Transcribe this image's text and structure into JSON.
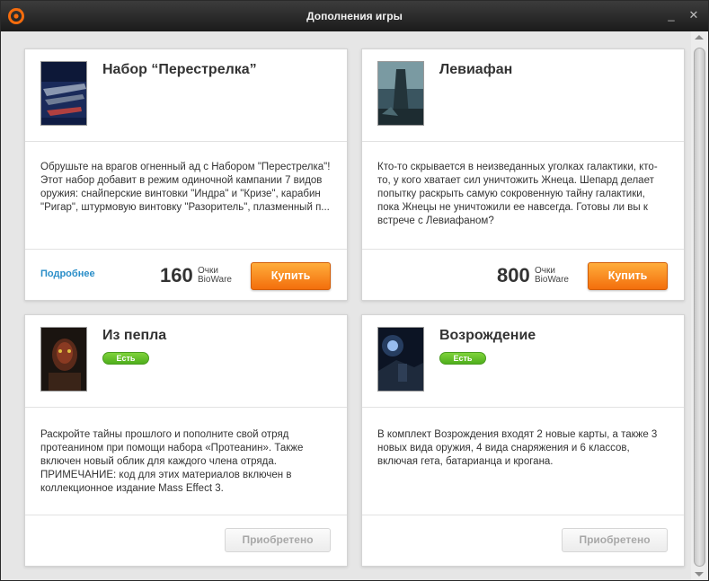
{
  "window": {
    "title": "Дополнения игры",
    "minimize_glyph": "_",
    "close_glyph": "✕"
  },
  "colors": {
    "accent_orange": "#f36e0c",
    "link_blue": "#2a8ec8",
    "badge_green": "#5cb82a"
  },
  "cards": [
    {
      "name": "Набор “Перестрелка”",
      "icon": "firefight-pack-cover",
      "description": "Обрушьте на врагов огненный ад с Набором \"Перестрелка\"! Этот набор добавит в режим одиночной кампании 7 видов оружия: снайперские винтовки \"Индра\" и \"Кризе\", карабин \"Ригар\", штурмовую винтовку \"Разоритель\", плазменный п...",
      "more_label": "Подробнее",
      "price": "160",
      "price_unit_1": "Очки",
      "price_unit_2": "BioWare",
      "buy_label": "Купить"
    },
    {
      "name": "Левиафан",
      "icon": "leviathan-cover",
      "description": "Кто-то скрывается в неизведанных уголках галактики, кто-то, у кого хватает сил уничтожить Жнеца. Шепард делает попытку раскрыть самую сокровенную тайну галактики, пока Жнецы не уничтожили ее навсегда. Готовы ли вы к встрече с Левиафаном?",
      "price": "800",
      "price_unit_1": "Очки",
      "price_unit_2": "BioWare",
      "buy_label": "Купить"
    },
    {
      "name": "Из пепла",
      "icon": "from-ashes-cover",
      "badge": "Есть",
      "description": "Раскройте тайны прошлого и пополните свой отряд протеанином при помощи набора «Протеанин». Также включен новый облик для каждого члена отряда. ПРИМЕЧАНИЕ: код для этих материалов включен в коллекционное издание Mass Effect 3.",
      "owned_label": "Приобретено"
    },
    {
      "name": "Возрождение",
      "icon": "resurgence-cover",
      "badge": "Есть",
      "description": "В комплект Возрождения входят 2 новые карты, а также 3 новых вида оружия, 4 вида снаряжения и 6 классов, включая гета, батарианца и крогана.",
      "owned_label": "Приобретено"
    }
  ]
}
